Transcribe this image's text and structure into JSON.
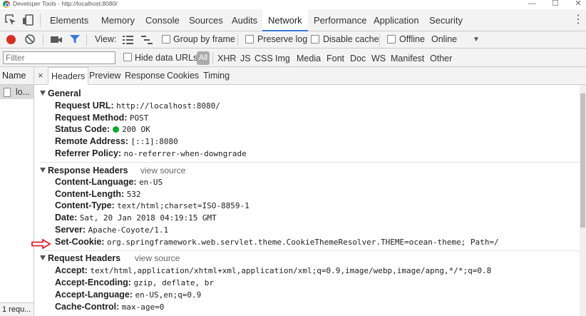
{
  "window": {
    "title": "Developer Tools - http://localhost:8080/",
    "min_glyph": "—",
    "max_glyph": "☐",
    "close_glyph": "✕"
  },
  "main_tabs": [
    "Elements",
    "Memory",
    "Console",
    "Sources",
    "Audits",
    "Network",
    "Performance",
    "Application",
    "Security"
  ],
  "active_main_tab": "Network",
  "more_glyph": "⋮",
  "network_toolbar": {
    "view_label": "View:",
    "group_by_frame": "Group by frame",
    "preserve_log": "Preserve log",
    "disable_cache": "Disable cache",
    "offline": "Offline",
    "throttle": "Online",
    "throttle_arrow": "▼"
  },
  "filter_bar": {
    "placeholder": "Filter",
    "hide_data_urls": "Hide data URLs",
    "all": "All",
    "types": [
      "XHR",
      "JS",
      "CSS",
      "Img",
      "Media",
      "Font",
      "Doc",
      "WS",
      "Manifest",
      "Other"
    ]
  },
  "requests": {
    "header": "Name",
    "rows": [
      "lo..."
    ],
    "status": "1 requ..."
  },
  "detail_tabs": {
    "close": "×",
    "tabs": [
      "Headers",
      "Preview",
      "Response",
      "Cookies",
      "Timing"
    ],
    "active": "Headers"
  },
  "general": {
    "title": "General",
    "rows": [
      {
        "k": "Request URL:",
        "v": "http://localhost:8080/"
      },
      {
        "k": "Request Method:",
        "v": "POST"
      },
      {
        "k": "Status Code:",
        "v": "200 OK"
      },
      {
        "k": "Remote Address:",
        "v": "[::1]:8080"
      },
      {
        "k": "Referrer Policy:",
        "v": "no-referrer-when-downgrade"
      }
    ]
  },
  "response_headers": {
    "title": "Response Headers",
    "view_source": "view source",
    "rows": [
      {
        "k": "Content-Language:",
        "v": "en-US"
      },
      {
        "k": "Content-Length:",
        "v": "532"
      },
      {
        "k": "Content-Type:",
        "v": "text/html;charset=ISO-8859-1"
      },
      {
        "k": "Date:",
        "v": "Sat, 20 Jan 2018 04:19:15 GMT"
      },
      {
        "k": "Server:",
        "v": "Apache-Coyote/1.1"
      },
      {
        "k": "Set-Cookie:",
        "v": "org.springframework.web.servlet.theme.CookieThemeResolver.THEME=ocean-theme; Path=/"
      }
    ]
  },
  "request_headers": {
    "title": "Request Headers",
    "view_source": "view source",
    "rows": [
      {
        "k": "Accept:",
        "v": "text/html,application/xhtml+xml,application/xml;q=0.9,image/webp,image/apng,*/*;q=0.8"
      },
      {
        "k": "Accept-Encoding:",
        "v": "gzip, deflate, br"
      },
      {
        "k": "Accept-Language:",
        "v": "en-US,en;q=0.9"
      },
      {
        "k": "Cache-Control:",
        "v": "max-age=0"
      }
    ]
  },
  "colors": {
    "record": "#d93025",
    "active_tab_underline": "#3879d9",
    "status_ok": "#0cab2e",
    "annotation_arrow": "#e8202a"
  }
}
